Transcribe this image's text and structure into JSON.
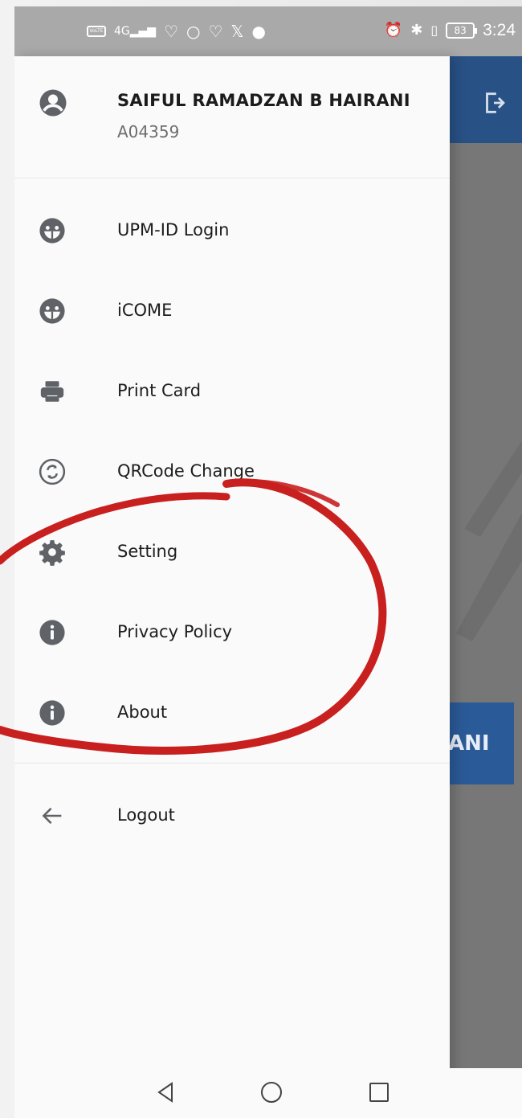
{
  "status_bar": {
    "time": "3:24",
    "battery": "83",
    "volte_label": "VoLTE",
    "network_label": "4G"
  },
  "drawer": {
    "user": {
      "name": "SAIFUL RAMADZAN B HAIRANI",
      "id": "A04359",
      "icon": "account-circle-icon"
    },
    "items": [
      {
        "label": "UPM-ID Login",
        "icon": "emoticon-icon"
      },
      {
        "label": "iCOME",
        "icon": "emoticon-icon"
      },
      {
        "label": "Print Card",
        "icon": "printer-icon"
      },
      {
        "label": "QRCode Change",
        "icon": "refresh-circle-icon"
      },
      {
        "label": "Setting",
        "icon": "gear-icon"
      },
      {
        "label": "Privacy Policy",
        "icon": "info-icon"
      },
      {
        "label": "About",
        "icon": "info-icon"
      }
    ],
    "logout": {
      "label": "Logout",
      "icon": "arrow-left-icon"
    }
  },
  "background_app": {
    "name_fragment": "ANI",
    "topbar_color": "#285186",
    "exit_icon": "exit-icon"
  },
  "colors": {
    "annotation_red": "#c8201f",
    "drawer_bg": "#fafafa",
    "icon_gray": "#5f6368"
  },
  "nav_bar": {
    "back_icon": "back-triangle-icon",
    "home_icon": "home-circle-icon",
    "recents_icon": "recents-square-icon"
  }
}
